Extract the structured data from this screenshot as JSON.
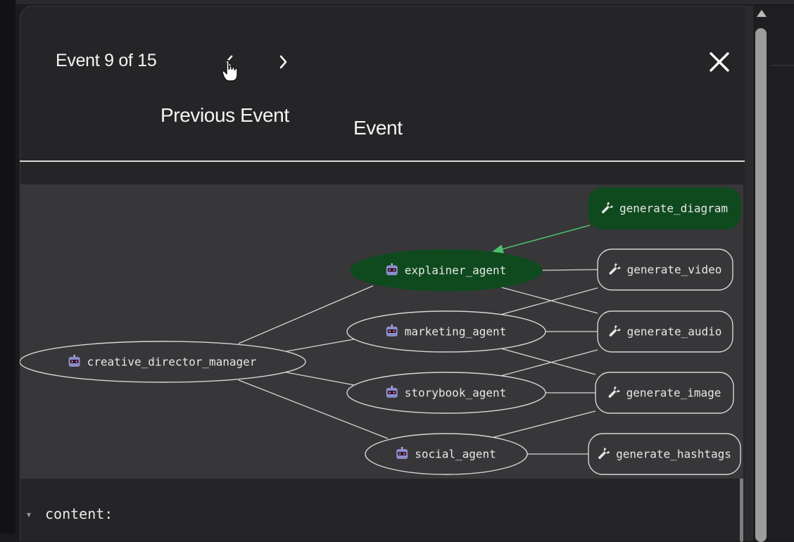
{
  "header": {
    "event_counter": "Event 9 of 15",
    "prev_tooltip": "Previous Event",
    "next_tooltip": "Event"
  },
  "icons": {
    "prev": "chevron-left-icon",
    "next": "chevron-right-icon",
    "close": "close-icon",
    "agent": "robot-icon",
    "tool": "wrench-icon"
  },
  "colors": {
    "active_node": "#0f4a1e",
    "active_edge": "#4fbf6a",
    "node_outline": "#d6d6d6",
    "graph_bg": "#373739"
  },
  "graph": {
    "nodes": [
      {
        "id": "creative_director_manager",
        "label": "creative_director_manager",
        "kind": "agent",
        "active": false
      },
      {
        "id": "explainer_agent",
        "label": "explainer_agent",
        "kind": "agent",
        "active": true
      },
      {
        "id": "marketing_agent",
        "label": "marketing_agent",
        "kind": "agent",
        "active": false
      },
      {
        "id": "storybook_agent",
        "label": "storybook_agent",
        "kind": "agent",
        "active": false
      },
      {
        "id": "social_agent",
        "label": "social_agent",
        "kind": "agent",
        "active": false
      },
      {
        "id": "generate_diagram",
        "label": "generate_diagram",
        "kind": "tool",
        "active": true
      },
      {
        "id": "generate_video",
        "label": "generate_video",
        "kind": "tool",
        "active": false
      },
      {
        "id": "generate_audio",
        "label": "generate_audio",
        "kind": "tool",
        "active": false
      },
      {
        "id": "generate_image",
        "label": "generate_image",
        "kind": "tool",
        "active": false
      },
      {
        "id": "generate_hashtags",
        "label": "generate_hashtags",
        "kind": "tool",
        "active": false
      }
    ],
    "edges": [
      {
        "from": "creative_director_manager",
        "to": "explainer_agent"
      },
      {
        "from": "creative_director_manager",
        "to": "marketing_agent"
      },
      {
        "from": "creative_director_manager",
        "to": "storybook_agent"
      },
      {
        "from": "creative_director_manager",
        "to": "social_agent"
      },
      {
        "from": "explainer_agent",
        "to": "generate_video"
      },
      {
        "from": "explainer_agent",
        "to": "generate_audio"
      },
      {
        "from": "marketing_agent",
        "to": "generate_video"
      },
      {
        "from": "marketing_agent",
        "to": "generate_audio"
      },
      {
        "from": "marketing_agent",
        "to": "generate_image"
      },
      {
        "from": "storybook_agent",
        "to": "generate_audio"
      },
      {
        "from": "storybook_agent",
        "to": "generate_image"
      },
      {
        "from": "social_agent",
        "to": "generate_image"
      },
      {
        "from": "social_agent",
        "to": "generate_hashtags"
      },
      {
        "from": "generate_diagram",
        "to": "explainer_agent",
        "active": true
      }
    ]
  },
  "details": {
    "toggle": "▾",
    "content_label": "content:"
  }
}
